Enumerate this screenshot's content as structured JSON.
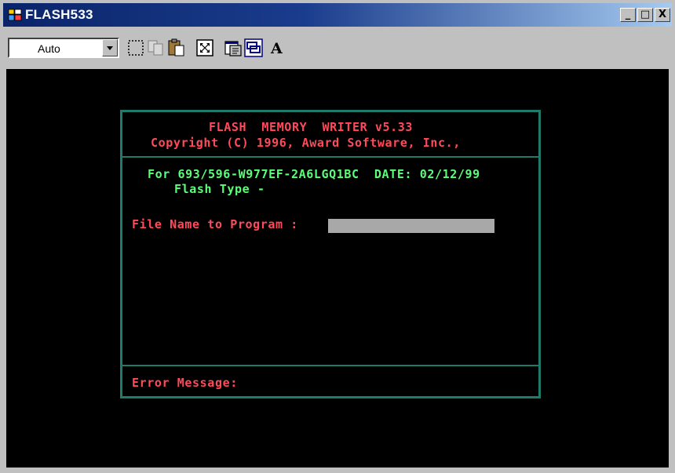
{
  "window": {
    "title": "FLASH533",
    "controls": {
      "minimize": "_",
      "maximize": "□",
      "close": "X"
    }
  },
  "toolbar": {
    "font_select_value": "Auto",
    "buttons": [
      {
        "name": "mark-icon"
      },
      {
        "name": "copy-icon"
      },
      {
        "name": "paste-icon"
      },
      {
        "name": "fullscreen-icon"
      },
      {
        "name": "properties-icon"
      },
      {
        "name": "background-icon"
      },
      {
        "name": "font-icon",
        "glyph": "A"
      }
    ]
  },
  "console": {
    "header_title": "FLASH  MEMORY  WRITER v5.33",
    "copyright": "Copyright (C) 1996, Award Software, Inc.,",
    "for_line": "For 693/596-W977EF-2A6LGQ1BC  DATE: 02/12/99",
    "flash_type": "Flash Type -",
    "file_prompt": "File Name to Program :",
    "file_value": "",
    "error_label": "Error Message:"
  },
  "colors": {
    "title_bar": "#0a246a",
    "console_bg": "#000000",
    "frame": "#1e7a6a",
    "red_text": "#ff4a5a",
    "green_text": "#5aff78",
    "input_bg": "#a8a8a8"
  }
}
